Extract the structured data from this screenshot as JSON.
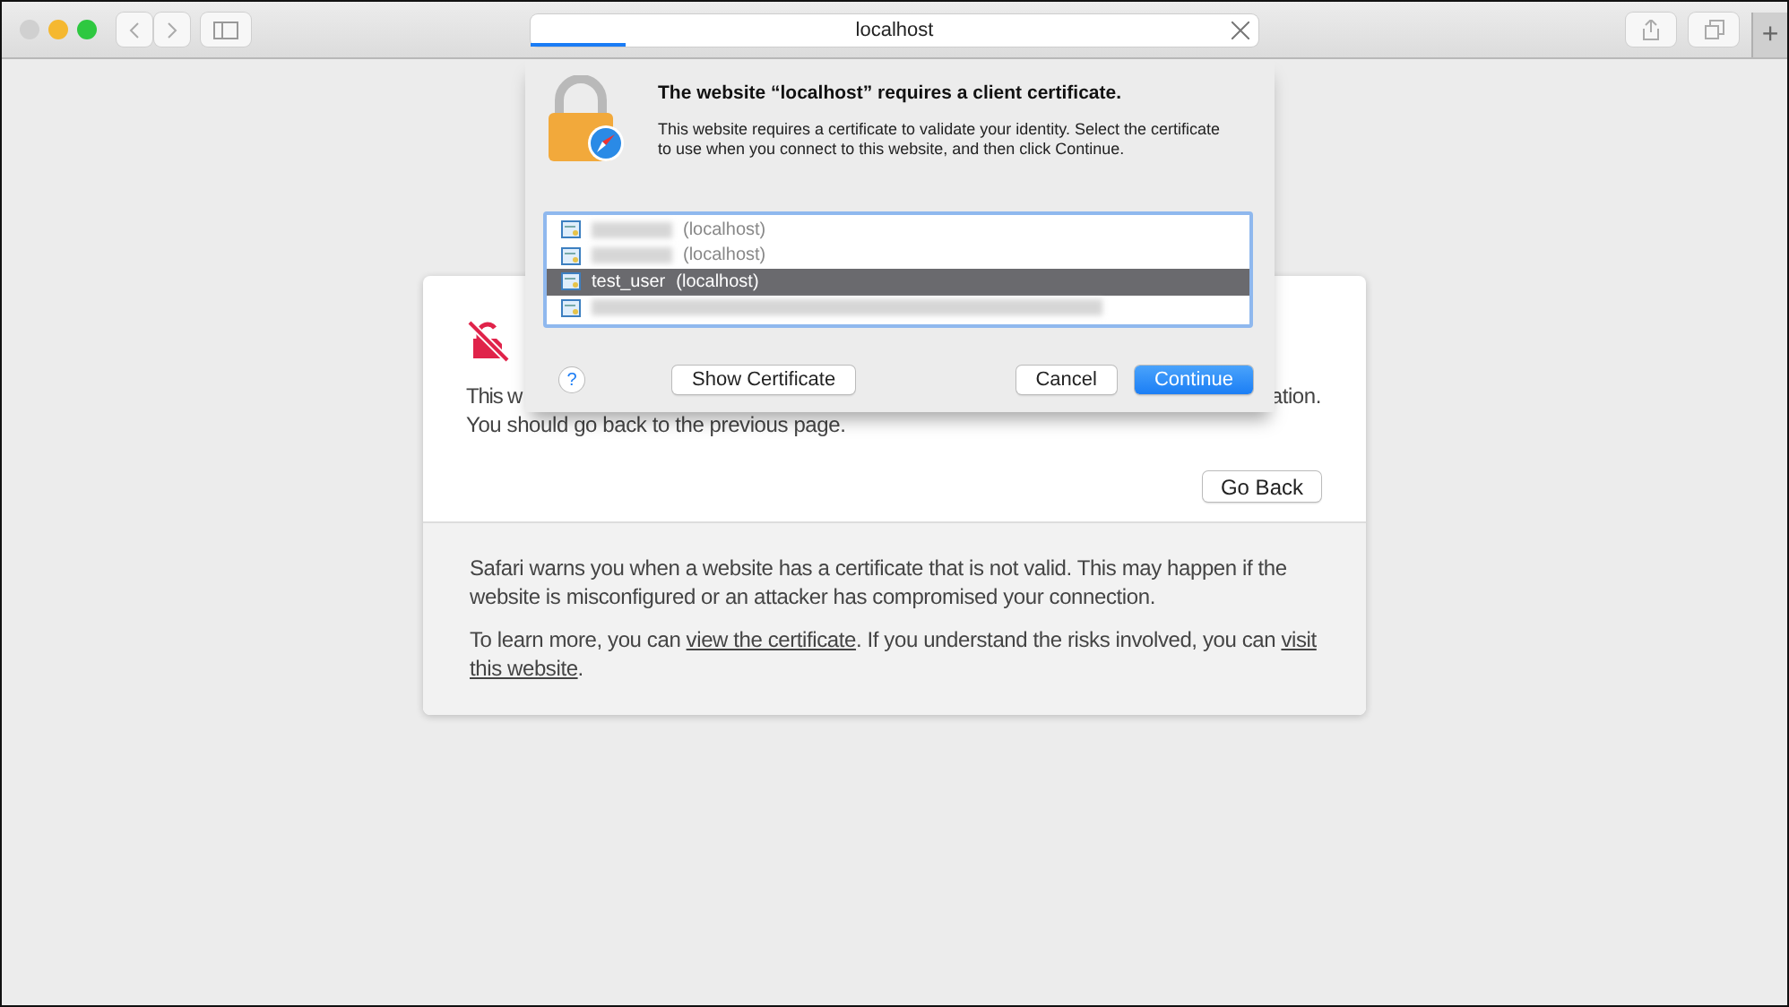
{
  "toolbar": {
    "address": "localhost",
    "loading": {
      "level": 0.13
    },
    "new_tab": "+"
  },
  "dialog": {
    "title": "The website “localhost” requires a client certificate.",
    "message": "This website requires a certificate to validate your identity. Select the certificate to use when you connect to this website, and then click Continue.",
    "certificates": [
      {
        "kind": "redacted",
        "suffix": "(localhost)",
        "selected": false
      },
      {
        "kind": "redacted",
        "suffix": "(localhost)",
        "selected": false
      },
      {
        "kind": "named",
        "name": "test_user",
        "suffix": "(localhost)",
        "selected": true
      },
      {
        "kind": "redacted",
        "selected": false
      }
    ],
    "help": "?",
    "buttons": [
      {
        "label": "Show Certificate",
        "kind": "normal"
      },
      {
        "label": "Cancel",
        "kind": "normal"
      },
      {
        "label": "Continue",
        "kind": "default"
      }
    ]
  },
  "warning": {
    "line_1_start": "This w",
    "line_1_end": "ation.",
    "line_2": "You should go back to the previous page.",
    "go_back": "Go Back",
    "details": "Safari warns you when a website has a certificate that is not valid. This may happen if the website is misconfigured or an attacker has compromised your connection.",
    "learn_prefix": "To learn more, you can ",
    "view_link": "view the certificate",
    "learn_middle": ". If you understand the risks involved, you can ",
    "visit_link_1": "visit",
    "visit_link_2": "this website",
    "learn_suffix": "."
  }
}
